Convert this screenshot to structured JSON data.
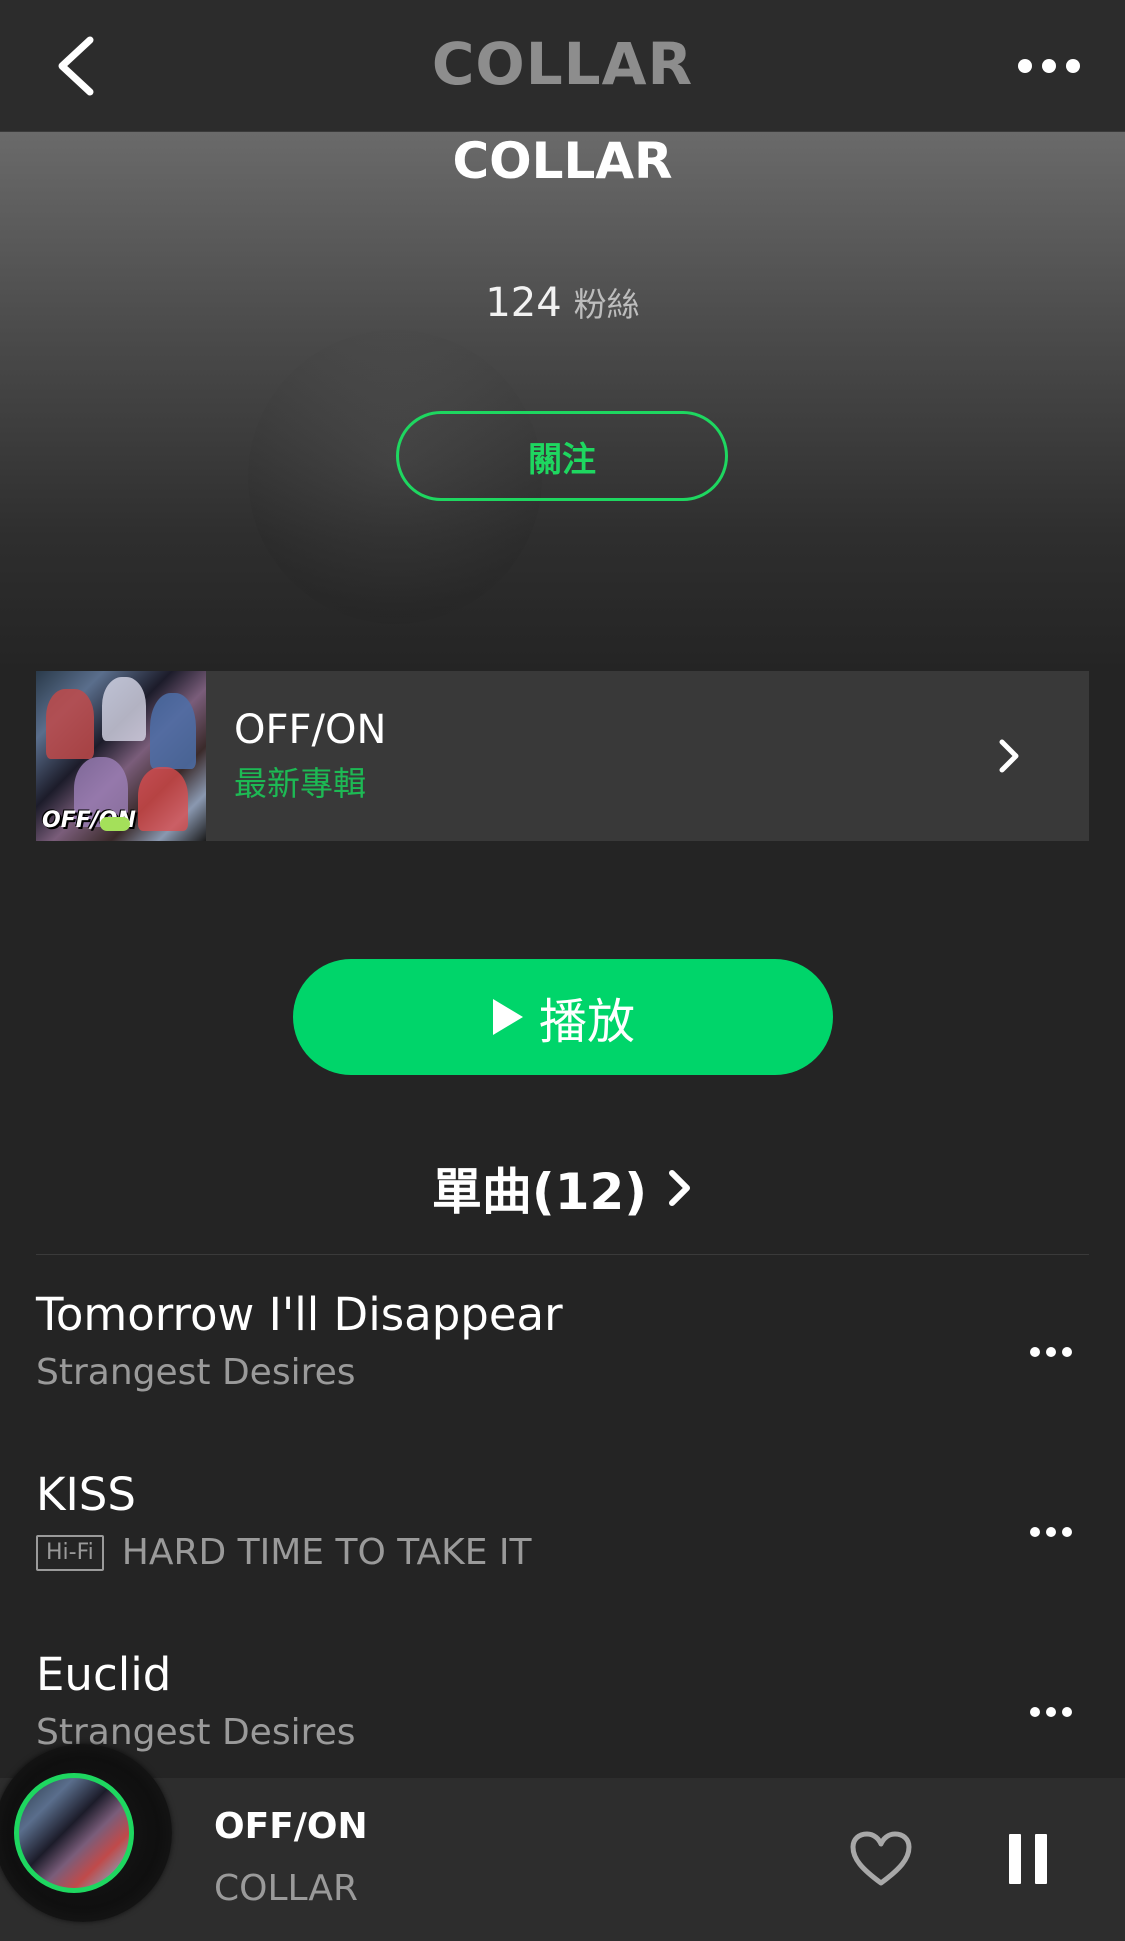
{
  "topbar": {
    "title": "COLLAR"
  },
  "artist": {
    "name": "COLLAR",
    "fans_count": "124",
    "fans_label": "粉絲",
    "follow_label": "關注"
  },
  "latest_album": {
    "title": "OFF/ON",
    "subtitle": "最新專輯",
    "cover_logo": "OFF/ON"
  },
  "play": {
    "label": "播放"
  },
  "singles": {
    "title": "單曲(12)"
  },
  "tracks": [
    {
      "title": "Tomorrow I'll Disappear",
      "subtitle": "Strangest Desires",
      "hifi": ""
    },
    {
      "title": "KISS",
      "subtitle": "HARD TIME TO TAKE IT",
      "hifi": "Hi-Fi"
    },
    {
      "title": "Euclid",
      "subtitle": "Strangest Desires",
      "hifi": ""
    }
  ],
  "player": {
    "title": "OFF/ON",
    "artist": "COLLAR"
  },
  "colors": {
    "accent": "#1ed760",
    "play_button": "#00d56a",
    "background": "#242424",
    "topbar": "#2c2c2c"
  },
  "icons": [
    "chevron-left-icon",
    "more-horizontal-icon",
    "chevron-right-icon",
    "play-icon",
    "heart-icon",
    "pause-icon"
  ]
}
